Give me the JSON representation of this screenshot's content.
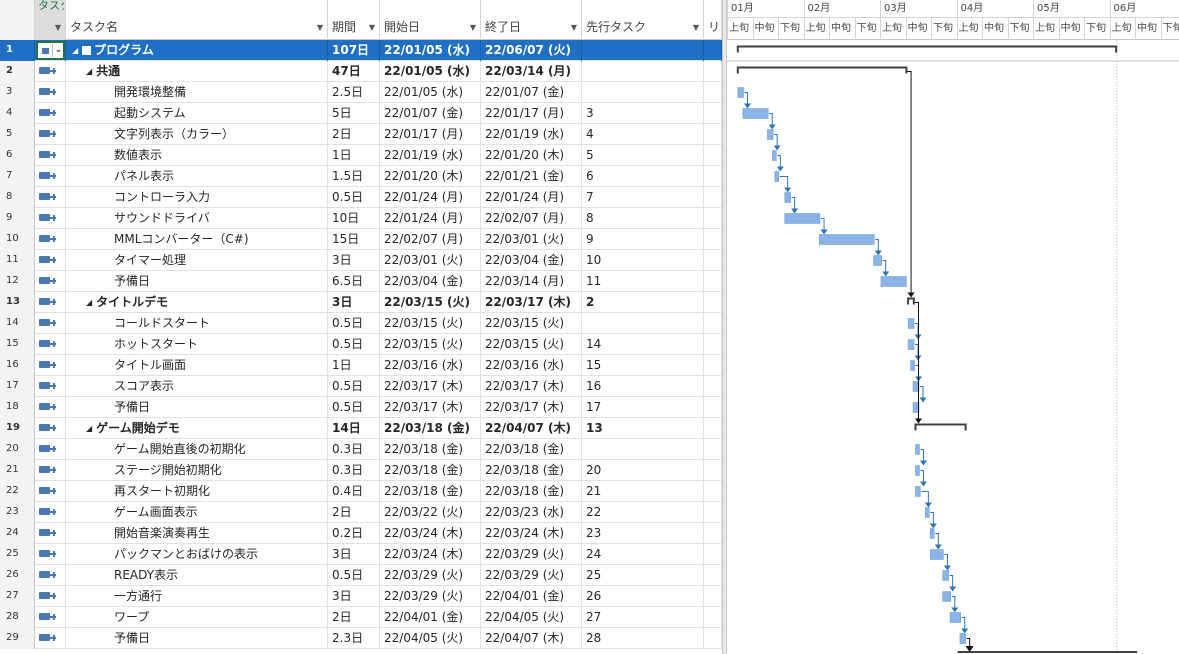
{
  "columns": {
    "mode": "タスクモード",
    "name": "タスク名",
    "duration": "期間",
    "start": "開始日",
    "finish": "終了日",
    "predecessors": "先行タスク",
    "resource": "リ"
  },
  "timeline": {
    "months": [
      "01月",
      "02月",
      "03月",
      "04月",
      "05月",
      "06月"
    ],
    "thirds": [
      "上旬",
      "中旬",
      "下旬"
    ]
  },
  "tasks": [
    {
      "id": "1",
      "name": "プログラム",
      "duration": "107日",
      "start": "22/01/05 (水)",
      "finish": "22/06/07 (火)",
      "pred": "",
      "level": 0,
      "summary": true,
      "selected": true
    },
    {
      "id": "2",
      "name": "共通",
      "duration": "47日",
      "start": "22/01/05 (水)",
      "finish": "22/03/14 (月)",
      "pred": "",
      "level": 1,
      "summary": true
    },
    {
      "id": "3",
      "name": "開発環境整備",
      "duration": "2.5日",
      "start": "22/01/05 (水)",
      "finish": "22/01/07 (金)",
      "pred": "",
      "level": 2
    },
    {
      "id": "4",
      "name": "起動システム",
      "duration": "5日",
      "start": "22/01/07 (金)",
      "finish": "22/01/17 (月)",
      "pred": "3",
      "level": 2
    },
    {
      "id": "5",
      "name": "文字列表示（カラー）",
      "duration": "2日",
      "start": "22/01/17 (月)",
      "finish": "22/01/19 (水)",
      "pred": "4",
      "level": 2
    },
    {
      "id": "6",
      "name": "数値表示",
      "duration": "1日",
      "start": "22/01/19 (水)",
      "finish": "22/01/20 (木)",
      "pred": "5",
      "level": 2
    },
    {
      "id": "7",
      "name": "パネル表示",
      "duration": "1.5日",
      "start": "22/01/20 (木)",
      "finish": "22/01/21 (金)",
      "pred": "6",
      "level": 2
    },
    {
      "id": "8",
      "name": "コントローラ入力",
      "duration": "0.5日",
      "start": "22/01/24 (月)",
      "finish": "22/01/24 (月)",
      "pred": "7",
      "level": 2
    },
    {
      "id": "9",
      "name": "サウンドドライバ",
      "duration": "10日",
      "start": "22/01/24 (月)",
      "finish": "22/02/07 (月)",
      "pred": "8",
      "level": 2
    },
    {
      "id": "10",
      "name": "MMLコンバーター（C#)",
      "duration": "15日",
      "start": "22/02/07 (月)",
      "finish": "22/03/01 (火)",
      "pred": "9",
      "level": 2
    },
    {
      "id": "11",
      "name": "タイマー処理",
      "duration": "3日",
      "start": "22/03/01 (火)",
      "finish": "22/03/04 (金)",
      "pred": "10",
      "level": 2
    },
    {
      "id": "12",
      "name": "予備日",
      "duration": "6.5日",
      "start": "22/03/04 (金)",
      "finish": "22/03/14 (月)",
      "pred": "11",
      "level": 2
    },
    {
      "id": "13",
      "name": "タイトルデモ",
      "duration": "3日",
      "start": "22/03/15 (火)",
      "finish": "22/03/17 (木)",
      "pred": "2",
      "level": 1,
      "summary": true
    },
    {
      "id": "14",
      "name": "コールドスタート",
      "duration": "0.5日",
      "start": "22/03/15 (火)",
      "finish": "22/03/15 (火)",
      "pred": "",
      "level": 2
    },
    {
      "id": "15",
      "name": "ホットスタート",
      "duration": "0.5日",
      "start": "22/03/15 (火)",
      "finish": "22/03/15 (火)",
      "pred": "14",
      "level": 2
    },
    {
      "id": "16",
      "name": "タイトル画面",
      "duration": "1日",
      "start": "22/03/16 (水)",
      "finish": "22/03/16 (水)",
      "pred": "15",
      "level": 2
    },
    {
      "id": "17",
      "name": "スコア表示",
      "duration": "0.5日",
      "start": "22/03/17 (木)",
      "finish": "22/03/17 (木)",
      "pred": "16",
      "level": 2
    },
    {
      "id": "18",
      "name": "予備日",
      "duration": "0.5日",
      "start": "22/03/17 (木)",
      "finish": "22/03/17 (木)",
      "pred": "17",
      "level": 2
    },
    {
      "id": "19",
      "name": "ゲーム開始デモ",
      "duration": "14日",
      "start": "22/03/18 (金)",
      "finish": "22/04/07 (木)",
      "pred": "13",
      "level": 1,
      "summary": true
    },
    {
      "id": "20",
      "name": "ゲーム開始直後の初期化",
      "duration": "0.3日",
      "start": "22/03/18 (金)",
      "finish": "22/03/18 (金)",
      "pred": "",
      "level": 2
    },
    {
      "id": "21",
      "name": "ステージ開始初期化",
      "duration": "0.3日",
      "start": "22/03/18 (金)",
      "finish": "22/03/18 (金)",
      "pred": "20",
      "level": 2
    },
    {
      "id": "22",
      "name": "再スタート初期化",
      "duration": "0.4日",
      "start": "22/03/18 (金)",
      "finish": "22/03/18 (金)",
      "pred": "21",
      "level": 2
    },
    {
      "id": "23",
      "name": "ゲーム画面表示",
      "duration": "2日",
      "start": "22/03/22 (火)",
      "finish": "22/03/23 (水)",
      "pred": "22",
      "level": 2
    },
    {
      "id": "24",
      "name": "開始音楽演奏再生",
      "duration": "0.2日",
      "start": "22/03/24 (木)",
      "finish": "22/03/24 (木)",
      "pred": "23",
      "level": 2
    },
    {
      "id": "25",
      "name": "パックマンとおばけの表示",
      "duration": "3日",
      "start": "22/03/24 (木)",
      "finish": "22/03/29 (火)",
      "pred": "24",
      "level": 2
    },
    {
      "id": "26",
      "name": "READY表示",
      "duration": "0.5日",
      "start": "22/03/29 (火)",
      "finish": "22/03/29 (火)",
      "pred": "25",
      "level": 2
    },
    {
      "id": "27",
      "name": "一方通行",
      "duration": "3日",
      "start": "22/03/29 (火)",
      "finish": "22/04/01 (金)",
      "pred": "26",
      "level": 2
    },
    {
      "id": "28",
      "name": "ワープ",
      "duration": "2日",
      "start": "22/04/01 (金)",
      "finish": "22/04/05 (火)",
      "pred": "27",
      "level": 2
    },
    {
      "id": "29",
      "name": "予備日",
      "duration": "2.3日",
      "start": "22/04/05 (火)",
      "finish": "22/04/07 (木)",
      "pred": "28",
      "level": 2
    }
  ],
  "colors": {
    "selected_row": "#1f6fc4",
    "task_bar": "#8ab4e6",
    "task_bar_edge": "#6a9bd6",
    "link_arrow": "#2e75b6",
    "summary_bar": "#404040",
    "mode_icon": "#4a78b0"
  }
}
